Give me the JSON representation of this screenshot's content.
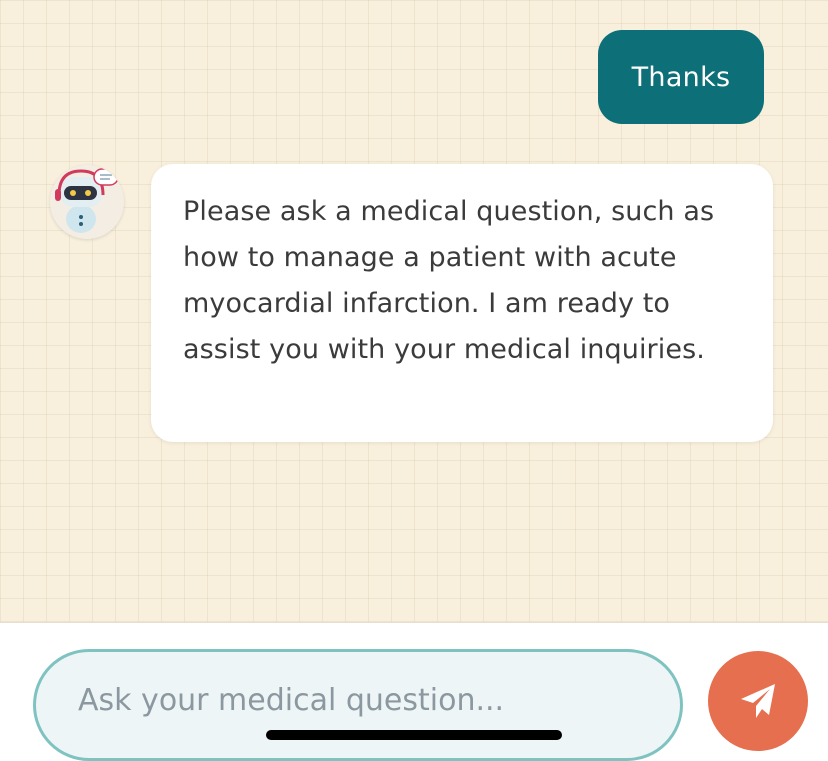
{
  "messages": {
    "user_message": "Thanks",
    "bot_message": "Please ask a medical question, such as how to manage a patient with acute myocardial infarction.  I am ready to assist you with your medical inquiries."
  },
  "composer": {
    "placeholder": "Ask your medical question...",
    "value": ""
  },
  "icons": {
    "avatar": "robot-avatar-icon",
    "send": "paper-plane-icon"
  },
  "colors": {
    "background": "#f8f0dd",
    "user_bubble": "#0d6f78",
    "send_button": "#e66f4f",
    "input_border": "#7fc3c1"
  }
}
